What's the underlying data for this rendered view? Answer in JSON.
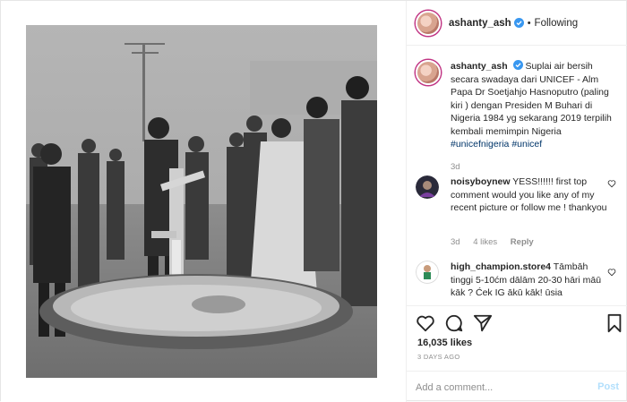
{
  "header": {
    "username": "ashanty_ash",
    "separator": "•",
    "follow_state": "Following"
  },
  "caption": {
    "username": "ashanty_ash",
    "text": "Suplai air bersih secara swadaya dari UNICEF - Alm Papa Dr Soetjahjo Hasnoputro (paling kiri ) dengan Presiden M Buhari di Nigeria 1984 yg sekarang 2019 terpilih kembali memimpin Nigeria",
    "hashtag1": "#unicefnigeria",
    "hashtag2": "#unicef",
    "time": "3d"
  },
  "comments": [
    {
      "username": "noisyboynew",
      "text": "YESS!!!!!! first top comment would you like any of my recent picture or follow me ! thankyou",
      "time": "3d",
      "likes": "4 likes",
      "reply": "Reply"
    },
    {
      "username": "high_champion.store4",
      "text": "Tāmbāh tinggi 5-10ćm dālām 20-30 hāri māū kāk ? Ćek IG ākū kāk! ūsia"
    }
  ],
  "post": {
    "likes": "16,035 likes",
    "date": "3 DAYS AGO"
  },
  "add_comment": {
    "placeholder": "Add a comment...",
    "post_label": "Post"
  },
  "icons": {
    "like": "heart-icon",
    "comment": "comment-icon",
    "share": "share-icon",
    "save": "bookmark-icon",
    "verified": "verified-badge-icon",
    "more": "more-options-icon"
  },
  "colors": {
    "verified": "#3897f0",
    "hashtag": "#003569",
    "muted": "#8e8e8e",
    "post_button": "#b2dffc"
  }
}
